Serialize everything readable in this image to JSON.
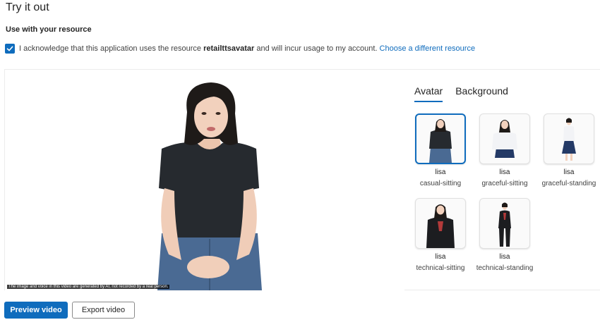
{
  "page": {
    "title": "Try it out",
    "section_label": "Use with your resource"
  },
  "acknowledge": {
    "checked": true,
    "text_before": "I acknowledge that this application uses the resource",
    "resource_name": "retailttsavatar",
    "text_after": "and will incur usage to my account.",
    "link_label": "Choose a different resource"
  },
  "video": {
    "caption": "The image and voice in this video are generated by AI, not recorded by a real person."
  },
  "tabs": [
    {
      "label": "Avatar",
      "active": true
    },
    {
      "label": "Background",
      "active": false
    }
  ],
  "avatars": [
    {
      "name": "lisa",
      "style": "casual-sitting",
      "selected": true
    },
    {
      "name": "lisa",
      "style": "graceful-sitting",
      "selected": false
    },
    {
      "name": "lisa",
      "style": "graceful-standing",
      "selected": false
    },
    {
      "name": "lisa",
      "style": "technical-sitting",
      "selected": false
    },
    {
      "name": "lisa",
      "style": "technical-standing",
      "selected": false
    }
  ],
  "buttons": {
    "preview_label": "Preview video",
    "export_label": "Export video"
  },
  "colors": {
    "accent": "#0f6cbd",
    "text": "#242424"
  }
}
